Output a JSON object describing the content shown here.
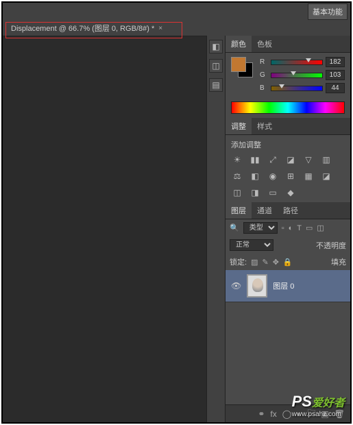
{
  "topbar": {
    "basic_button": "基本功能"
  },
  "document_tab": {
    "title": "Displacement @ 66.7% (图层 0, RGB/8#) *"
  },
  "panels": {
    "color": {
      "tab_color": "颜色",
      "tab_swatches": "色板",
      "fg_color": "#c17831",
      "bg_color": "#000000",
      "r_label": "R",
      "r_value": "182",
      "g_label": "G",
      "g_value": "103",
      "b_label": "B",
      "b_value": "44"
    },
    "adjustments": {
      "tab_adjust": "调整",
      "tab_styles": "样式",
      "heading": "添加调整"
    },
    "layers": {
      "tab_layers": "图层",
      "tab_channels": "通道",
      "tab_paths": "路径",
      "kind_label": "类型",
      "blend_mode": "正常",
      "opacity_label": "不透明度",
      "lock_label": "锁定:",
      "fill_label": "填充",
      "layer0_name": "图层 0"
    }
  },
  "watermark": {
    "brand": "PS",
    "text": "爱好者",
    "url": "www.psahz.com"
  }
}
